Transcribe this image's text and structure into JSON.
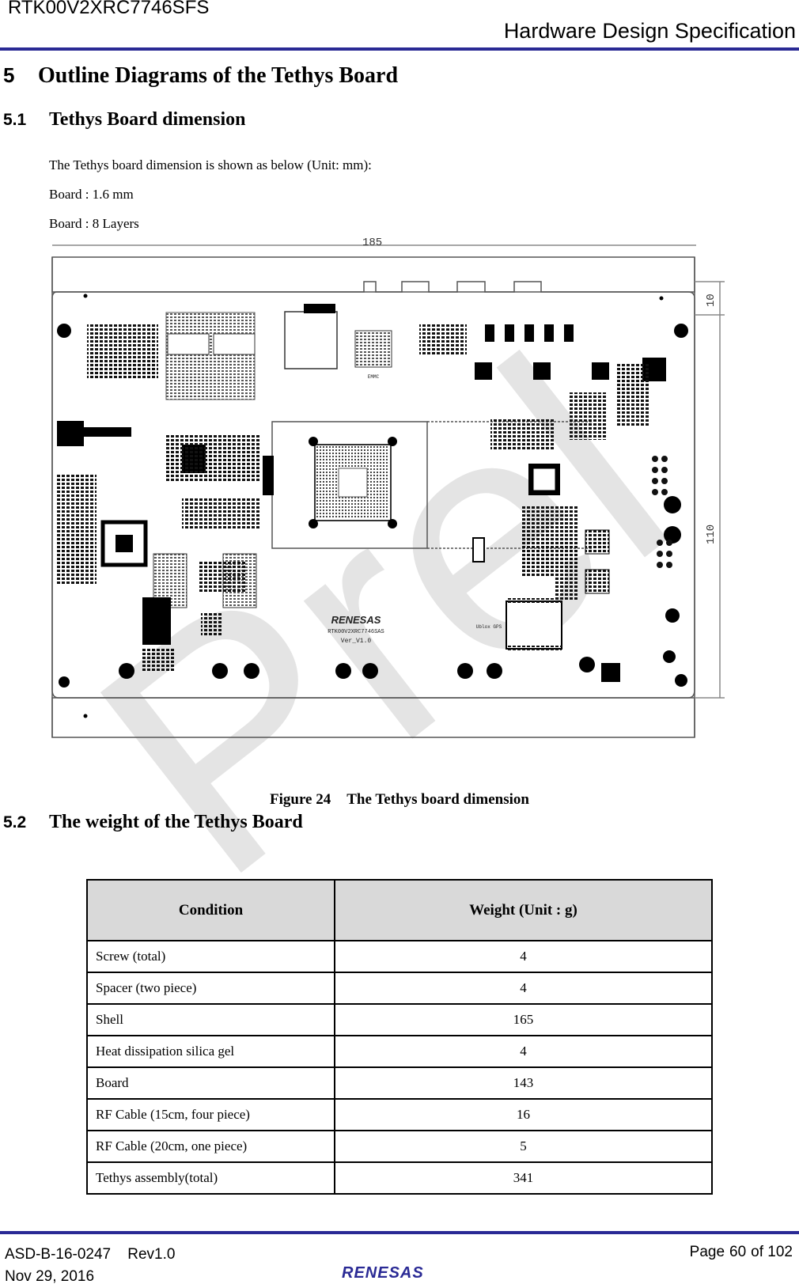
{
  "header": {
    "doc_id": "RTK00V2XRC7746SFS",
    "doc_title": "Hardware Design Specification",
    "rule_color": "#2a2a95"
  },
  "watermark": "Prel",
  "section5": {
    "number": "5",
    "title": "Outline Diagrams of the Tethys Board"
  },
  "section5_1": {
    "number": "5.1",
    "title": "Tethys Board dimension",
    "paragraphs": [
      "The Tethys board dimension is shown as below (Unit: mm):",
      "Board : 1.6 mm",
      "Board : 8 Layers"
    ]
  },
  "figure": {
    "label": "Figure 24",
    "title": "The Tethys board dimension",
    "dimensions": {
      "width": "185",
      "top_margin": "10",
      "height": "110"
    },
    "silkscreen": {
      "logo": "RENESAS",
      "part": "RTK00V2XRC7746SAS",
      "version": "Ver_V1.0",
      "module": "Ublox GPS",
      "emmc": "EMMC"
    }
  },
  "section5_2": {
    "number": "5.2",
    "title": "The weight of the Tethys Board",
    "table": {
      "headers": [
        "Condition",
        "Weight (Unit : g)"
      ],
      "rows": [
        [
          "Screw (total)",
          "4"
        ],
        [
          "Spacer (two piece)",
          "4"
        ],
        [
          "Shell",
          "165"
        ],
        [
          "Heat dissipation silica gel",
          "4"
        ],
        [
          "Board",
          "143"
        ],
        [
          "RF Cable (15cm, four piece)",
          "16"
        ],
        [
          "RF Cable (20cm, one piece)",
          "5"
        ],
        [
          "Tethys assembly(total)",
          "341"
        ]
      ]
    }
  },
  "footer": {
    "doc_number": "ASD-B-16-0247",
    "revision": "Rev1.0",
    "date": "Nov 29, 2016",
    "page_label": "Page",
    "page": "60",
    "of_label": "of 102",
    "logo": "RENESAS"
  }
}
